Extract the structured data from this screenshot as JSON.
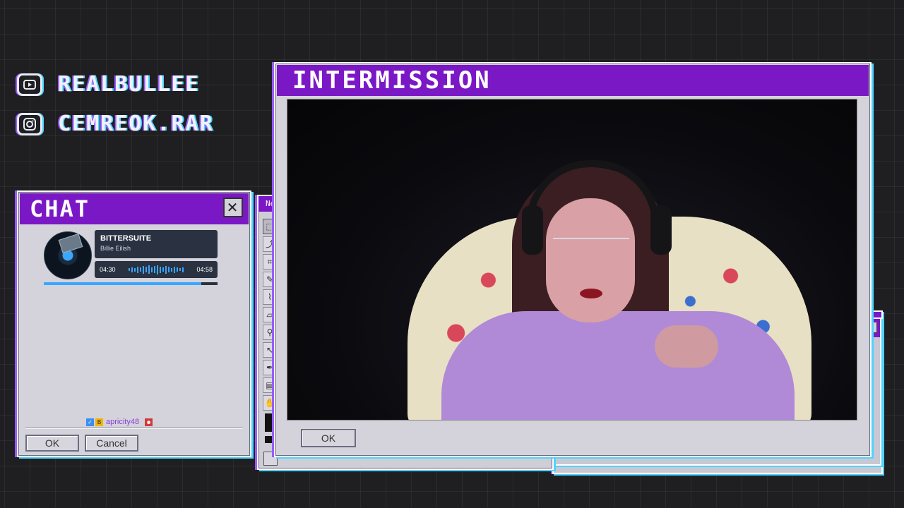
{
  "social": {
    "youtube": {
      "icon": "youtube-icon",
      "handle": "REALBULLEE"
    },
    "instagram": {
      "icon": "instagram-icon",
      "handle": "CEMREOK.RAR"
    }
  },
  "chat_window": {
    "title": "CHAT",
    "close_label": "✕",
    "now_playing": {
      "title": "BITTERSUITE",
      "artist": "Billie Eilish",
      "elapsed": "04:30",
      "duration": "04:58",
      "progress_fraction": 0.906
    },
    "message": {
      "username": "apricity48"
    },
    "buttons": {
      "ok": "OK",
      "cancel": "Cancel"
    }
  },
  "paint_window": {
    "title_fragment": "Ne"
  },
  "intermission_window": {
    "title": "INTERMISSION",
    "ok_label": "OK"
  },
  "colors": {
    "title_bar": "#7b18c6",
    "window_face": "#d4d3db",
    "chromatic_left": "#9a5cff",
    "chromatic_right": "#4fd3ff",
    "music_accent": "#3aa6ff",
    "background": "#1f1f22"
  }
}
